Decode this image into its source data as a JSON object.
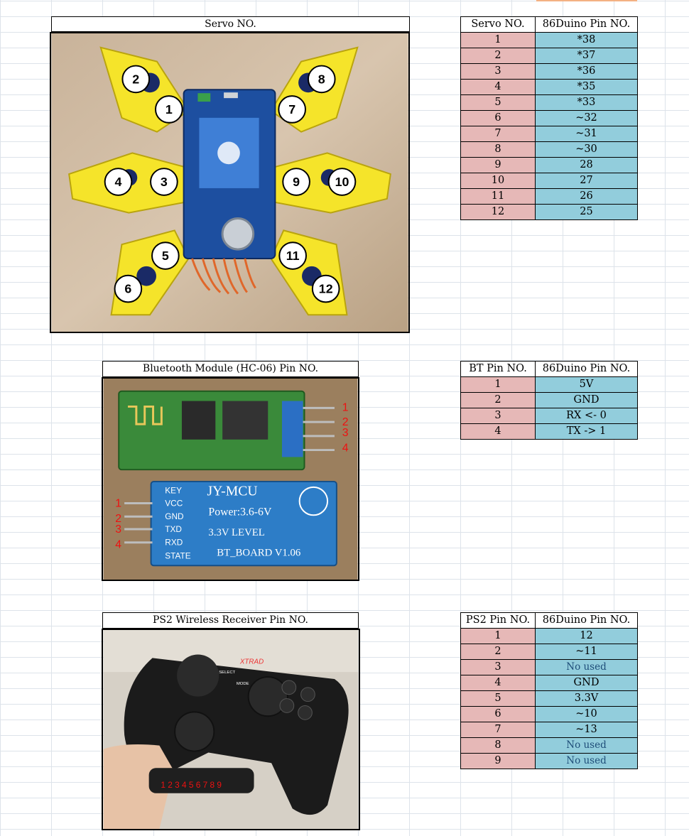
{
  "servo": {
    "caption": "Servo NO.",
    "photo_labels": [
      "1",
      "2",
      "3",
      "4",
      "5",
      "6",
      "7",
      "8",
      "9",
      "10",
      "11",
      "12"
    ],
    "table": {
      "headers": [
        "Servo NO.",
        "86Duino Pin NO."
      ],
      "rows": [
        {
          "a": "1",
          "b": "*38"
        },
        {
          "a": "2",
          "b": "*37"
        },
        {
          "a": "3",
          "b": "*36"
        },
        {
          "a": "4",
          "b": "*35"
        },
        {
          "a": "5",
          "b": "*33"
        },
        {
          "a": "6",
          "b": "~32"
        },
        {
          "a": "7",
          "b": "~31"
        },
        {
          "a": "8",
          "b": "~30"
        },
        {
          "a": "9",
          "b": "28"
        },
        {
          "a": "10",
          "b": "27"
        },
        {
          "a": "11",
          "b": "26"
        },
        {
          "a": "12",
          "b": "25"
        }
      ]
    }
  },
  "bluetooth": {
    "caption": "Bluetooth Module (HC-06) Pin NO.",
    "photo": {
      "board_title": "JY-MCU",
      "power": "Power:3.6-6V",
      "level": "3.3V  LEVEL",
      "board": "BT_BOARD  V1.06",
      "pins": [
        "KEY",
        "VCC",
        "GND",
        "TXD",
        "RXD",
        "STATE"
      ],
      "numbers": [
        "1",
        "2",
        "3",
        "4"
      ]
    },
    "table": {
      "headers": [
        "BT Pin NO.",
        "86Duino Pin NO."
      ],
      "rows": [
        {
          "a": "1",
          "b": "5V"
        },
        {
          "a": "2",
          "b": "GND"
        },
        {
          "a": "3",
          "b": "RX <- 0"
        },
        {
          "a": "4",
          "b": "TX -> 1"
        }
      ]
    }
  },
  "ps2": {
    "caption": "PS2 Wireless Receiver Pin NO.",
    "photo": {
      "brand": "XTRAD",
      "select": "SELECT",
      "mode": "MODE",
      "connector_pins": "1 2 3 4 5 6 7 8 9"
    },
    "table": {
      "headers": [
        "PS2 Pin NO.",
        "86Duino Pin NO."
      ],
      "rows": [
        {
          "a": "1",
          "b": "12",
          "unused": false
        },
        {
          "a": "2",
          "b": "~11",
          "unused": false
        },
        {
          "a": "3",
          "b": "No used",
          "unused": true
        },
        {
          "a": "4",
          "b": "GND",
          "unused": false
        },
        {
          "a": "5",
          "b": "3.3V",
          "unused": false
        },
        {
          "a": "6",
          "b": "~10",
          "unused": false
        },
        {
          "a": "7",
          "b": "~13",
          "unused": false
        },
        {
          "a": "8",
          "b": "No used",
          "unused": true
        },
        {
          "a": "9",
          "b": "No used",
          "unused": true
        }
      ]
    }
  },
  "colors": {
    "pin_col": "#e6b8b7",
    "duino_col": "#92cddc",
    "no_used_text": "#1f4e79",
    "robot_yellow": "#f5e42a",
    "pcb_blue": "#1d4fa0"
  }
}
